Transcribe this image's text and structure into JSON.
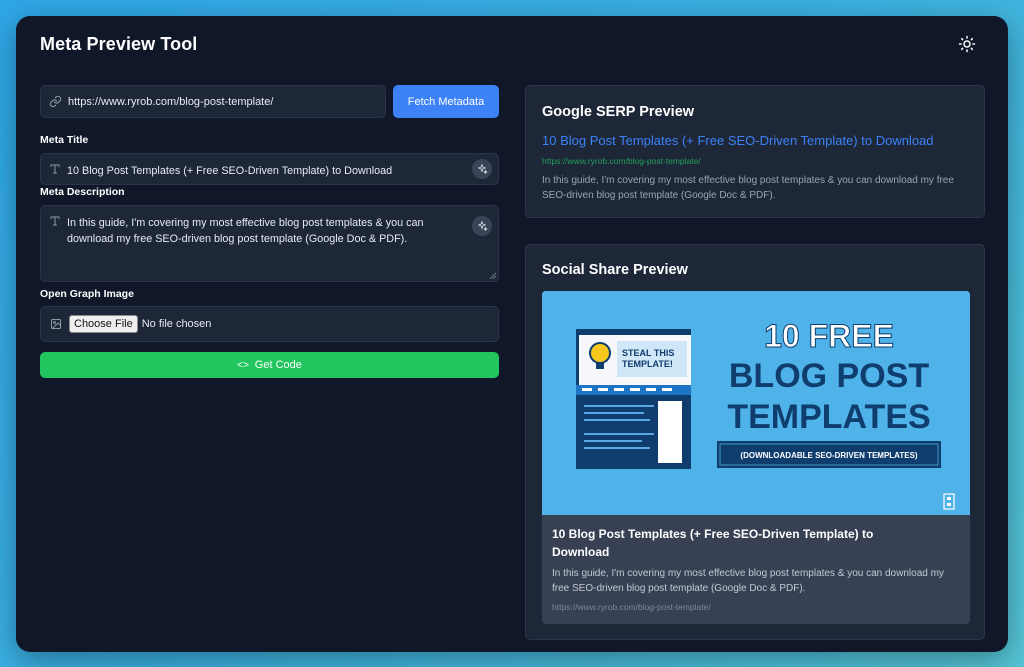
{
  "app": {
    "title": "Meta Preview Tool",
    "theme_icon": "sun-icon"
  },
  "url_input": {
    "value": "https://www.ryrob.com/blog-post-template/",
    "icon": "link-icon"
  },
  "fetch_button": {
    "label": "Fetch Metadata"
  },
  "meta_title": {
    "label": "Meta Title",
    "value": "10 Blog Post Templates (+ Free SEO-Driven Template) to Download"
  },
  "meta_description": {
    "label": "Meta Description",
    "value": "In this guide, I'm covering my most effective blog post templates & you can download my free SEO-driven blog post template (Google Doc & PDF)."
  },
  "og_image": {
    "label": "Open Graph Image",
    "choose_label": "Choose File",
    "status": "No file chosen"
  },
  "get_code_button": {
    "label": "Get Code",
    "glyph": "<>"
  },
  "serp": {
    "heading": "Google SERP Preview",
    "title": "10 Blog Post Templates (+ Free SEO-Driven Template) to Download",
    "url": "https://www.ryrob.com/blog-post-template/",
    "description": "In this guide, I'm covering my most effective blog post templates & you can download my free SEO-driven blog post template (Google Doc & PDF)."
  },
  "social": {
    "heading": "Social Share Preview",
    "image": {
      "badge_text": [
        "STEAL THIS",
        "TEMPLATE!"
      ],
      "headline": [
        "10 FREE",
        "BLOG POST",
        "TEMPLATES"
      ],
      "subline": "(DOWNLOADABLE SEO-DRIVEN TEMPLATES)"
    },
    "title": "10 Blog Post Templates (+ Free SEO-Driven Template) to Download",
    "description": "In this guide, I'm covering my most effective blog post templates & you can download my free SEO-driven blog post template (Google Doc & PDF).",
    "url": "https://www.ryrob.com/blog-post-template/"
  },
  "colors": {
    "accent_blue": "#3c82f6",
    "accent_green": "#22c55e",
    "panel_bg": "#1e2738",
    "window_bg": "#0f1728"
  }
}
